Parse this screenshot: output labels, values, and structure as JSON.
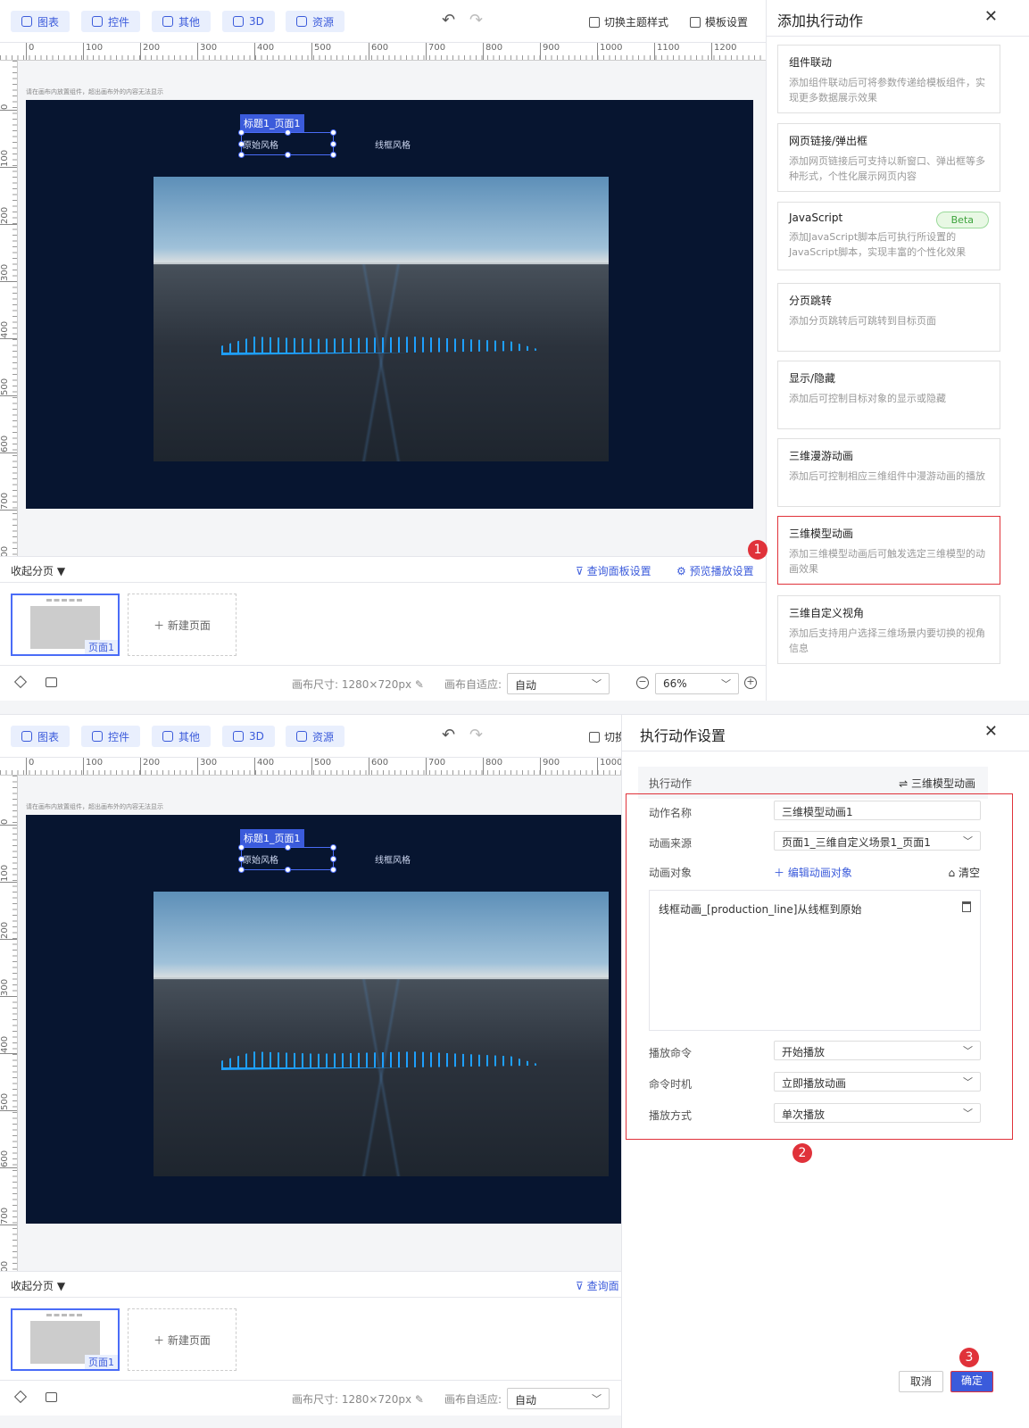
{
  "toolbar": {
    "chart": "图表",
    "widget": "控件",
    "other": "其他",
    "three_d": "3D",
    "resource": "资源",
    "switch_theme": "切换主题样式",
    "template_settings": "模板设置",
    "switch_theme_truncated": "切换"
  },
  "ruler": {
    "top": [
      "0",
      "100",
      "200",
      "300",
      "400",
      "500",
      "600",
      "700",
      "800",
      "900",
      "1000",
      "1100",
      "1200"
    ],
    "left": [
      "0",
      "100",
      "200",
      "300",
      "400",
      "500",
      "600",
      "700",
      "800"
    ]
  },
  "canvas": {
    "hint": "请在画布内放置组件，超出画布外的内容无法显示",
    "selected_tag": "标题1_页面1",
    "style_original": "原始风格",
    "style_wireframe": "线框风格"
  },
  "pages": {
    "collapse": "收起分页 ▼",
    "query_panel": "查询面板设置",
    "query_panel_truncated": "查询面",
    "preview_settings": "预览播放设置",
    "page1": "页面1",
    "new_page": "＋ 新建页面"
  },
  "statusbar": {
    "canvas_size_label": "画布尺寸:",
    "canvas_size_value": "1280×720px",
    "adapt_label": "画布自适应:",
    "adapt_value": "自动",
    "zoom": "66%"
  },
  "add_action_panel": {
    "title": "添加执行动作",
    "cards": [
      {
        "title": "组件联动",
        "desc": "添加组件联动后可将参数传递给模板组件，实现更多数据展示效果"
      },
      {
        "title": "网页链接/弹出框",
        "desc": "添加网页链接后可支持以新窗口、弹出框等多种形式，个性化展示网页内容"
      },
      {
        "title": "JavaScript",
        "desc": "添加JavaScript脚本后可执行所设置的JavaScript脚本，实现丰富的个性化效果",
        "badge": "Beta"
      },
      {
        "title": "分页跳转",
        "desc": "添加分页跳转后可跳转到目标页面"
      },
      {
        "title": "显示/隐藏",
        "desc": "添加后可控制目标对象的显示或隐藏"
      },
      {
        "title": "三维漫游动画",
        "desc": "添加后可控制相应三维组件中漫游动画的播放"
      },
      {
        "title": "三维模型动画",
        "desc": "添加三维模型动画后可触发选定三维模型的动画效果"
      },
      {
        "title": "三维自定义视角",
        "desc": "添加后支持用户选择三维场景内要切换的视角信息"
      }
    ]
  },
  "settings_panel": {
    "title": "执行动作设置",
    "action_label": "执行动作",
    "action_value": "⇌ 三维模型动画",
    "name_label": "动作名称",
    "name_value": "三维模型动画1",
    "source_label": "动画来源",
    "source_value": "页面1_三维自定义场景1_页面1",
    "target_label": "动画对象",
    "edit_target": "＋ 编辑动画对象",
    "clear": "清空",
    "target_item": "线框动画_[production_line]从线框到原始",
    "play_cmd_label": "播放命令",
    "play_cmd_value": "开始播放",
    "cmd_timing_label": "命令时机",
    "cmd_timing_value": "立即播放动画",
    "play_mode_label": "播放方式",
    "play_mode_value": "单次播放",
    "cancel": "取消",
    "confirm": "确定"
  },
  "steps": [
    "1",
    "2",
    "3"
  ]
}
